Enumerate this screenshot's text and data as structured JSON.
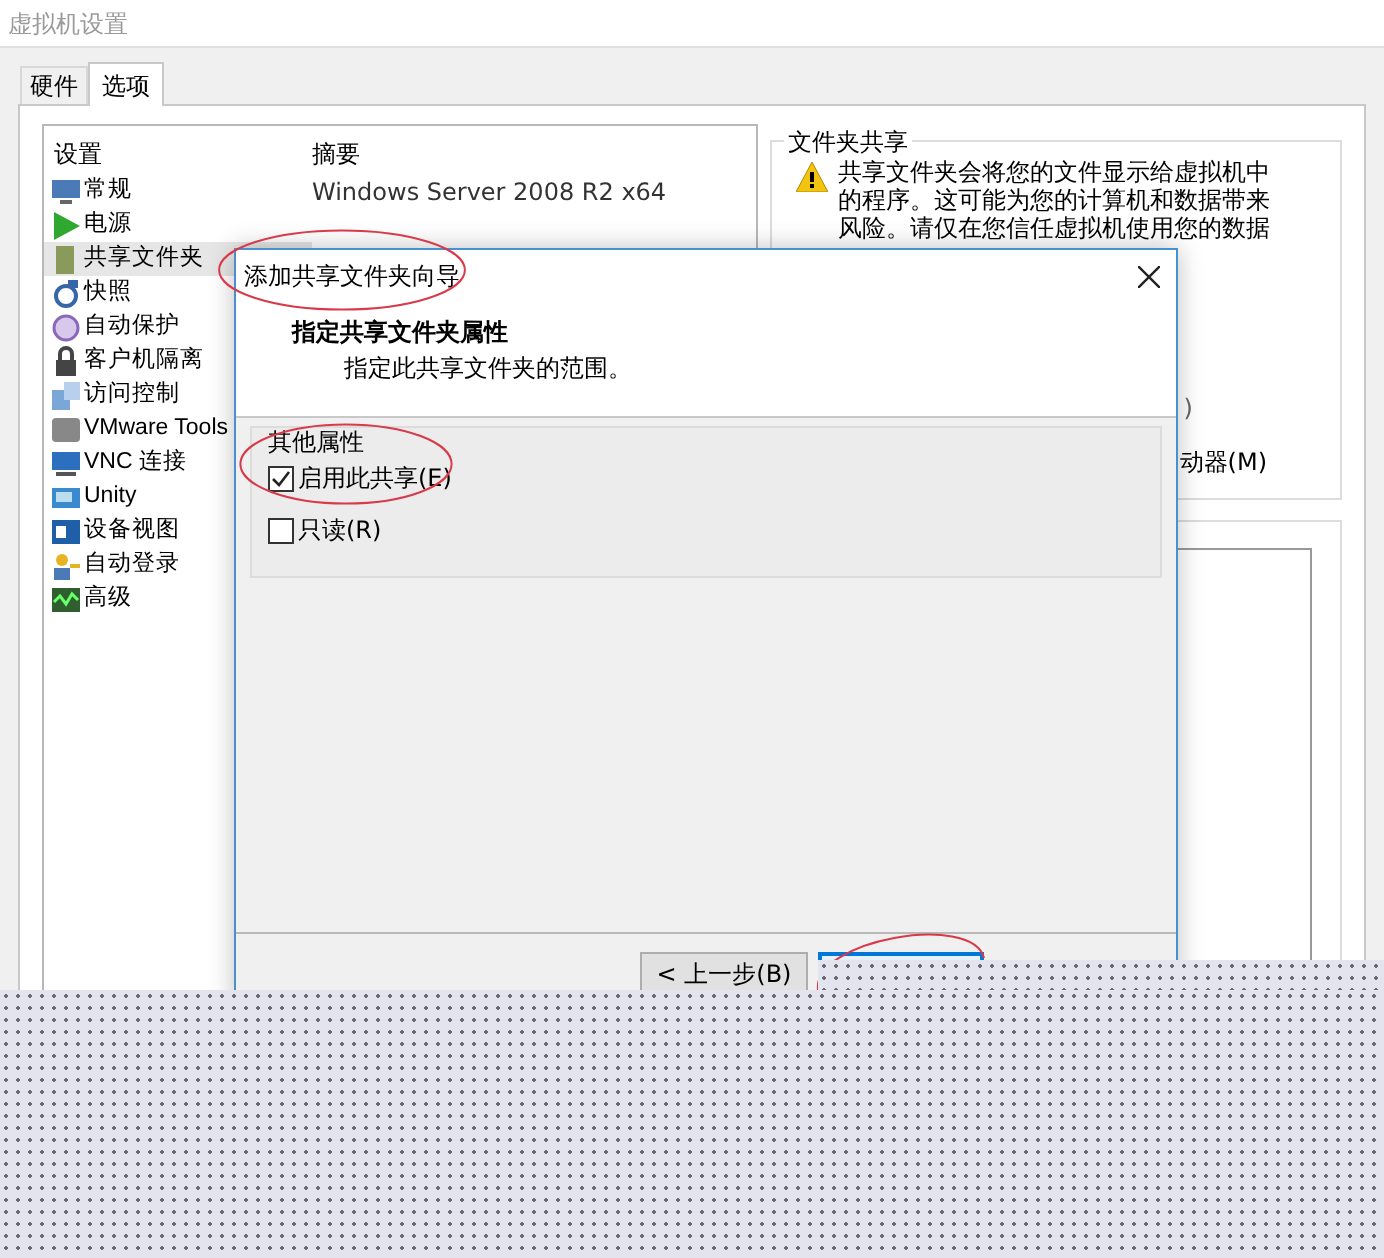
{
  "window": {
    "title": "虚拟机设置"
  },
  "tabs": [
    {
      "label": "硬件",
      "selected": false
    },
    {
      "label": "选项",
      "selected": true
    }
  ],
  "settings_list": {
    "columns": [
      "设置",
      "摘要"
    ],
    "items": [
      {
        "label": "常规",
        "summary": "Windows Server 2008 R2 x64",
        "selected": false
      },
      {
        "label": "电源",
        "selected": false
      },
      {
        "label": "共享文件夹",
        "selected": true
      },
      {
        "label": "快照",
        "selected": false
      },
      {
        "label": "自动保护",
        "selected": false
      },
      {
        "label": "客户机隔离",
        "selected": false
      },
      {
        "label": "访问控制",
        "selected": false
      },
      {
        "label": "VMware Tools",
        "selected": false
      },
      {
        "label": "VNC 连接",
        "selected": false
      },
      {
        "label": "Unity",
        "selected": false
      },
      {
        "label": "设备视图",
        "selected": false
      },
      {
        "label": "自动登录",
        "selected": false
      },
      {
        "label": "高级",
        "selected": false
      }
    ]
  },
  "folder_sharing": {
    "title": "文件夹共享",
    "warning_lines": [
      "共享文件夹会将您的文件显示给虚拟机中",
      "的程序。这可能为您的计算机和数据带来",
      "风险。请仅在您信任虚拟机使用您的数据"
    ],
    "partial_texts": [
      ")",
      "动器(M)"
    ]
  },
  "dialog": {
    "title": "添加共享文件夹向导",
    "heading": "指定共享文件夹属性",
    "subheading": "指定此共享文件夹的范围。",
    "group": {
      "title": "其他属性",
      "options": [
        {
          "label": "启用此共享(E)",
          "checked": true
        },
        {
          "label": "只读(R)",
          "checked": false
        }
      ]
    },
    "buttons": [
      "< 上一步(B)"
    ]
  }
}
